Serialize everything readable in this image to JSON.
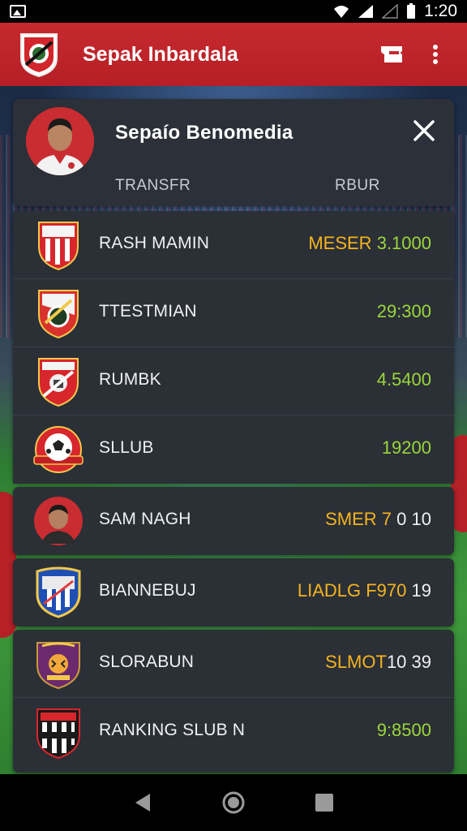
{
  "status_bar": {
    "time": "1:20"
  },
  "app_bar": {
    "title": "Sepak Inbardala"
  },
  "profile": {
    "name": "Sepaío Benomedia",
    "tabs": [
      "TRANSFR",
      "RBUR"
    ]
  },
  "rows": [
    {
      "label": "RASH MAMIN",
      "value_a": "MESER",
      "value_b": "3.1000",
      "icon": "club-crest-stripes"
    },
    {
      "label": "TTESTMIAN",
      "value_a": "",
      "value_b": "29:300",
      "icon": "club-crest-ball"
    },
    {
      "label": "RUMBK",
      "value_a": "",
      "value_b": "4.5400",
      "icon": "club-crest-knight"
    },
    {
      "label": "SLLUB",
      "value_a": "",
      "value_b": "19200",
      "icon": "football-badge"
    },
    {
      "label": "SAM NAGH",
      "value_a": "SMER 7",
      "value_b": "0 10",
      "icon": "player-avatar"
    },
    {
      "label": "BIANNEBUJ",
      "value_a": "LIADLG F970",
      "value_b": "19",
      "icon": "club-shield-blue"
    },
    {
      "label": "SLORABUN",
      "value_a": "SLMOT",
      "value_b": "10 39",
      "icon": "club-crest-tiger"
    },
    {
      "label": "RANKING SLUB N",
      "value_a": "",
      "value_b": "9:8500",
      "icon": "club-crest-black-white"
    }
  ],
  "colors": {
    "app_bar": "#c62a2f",
    "card": "#2b2f36",
    "gold": "#f5b41f",
    "green": "#9ad73a"
  }
}
